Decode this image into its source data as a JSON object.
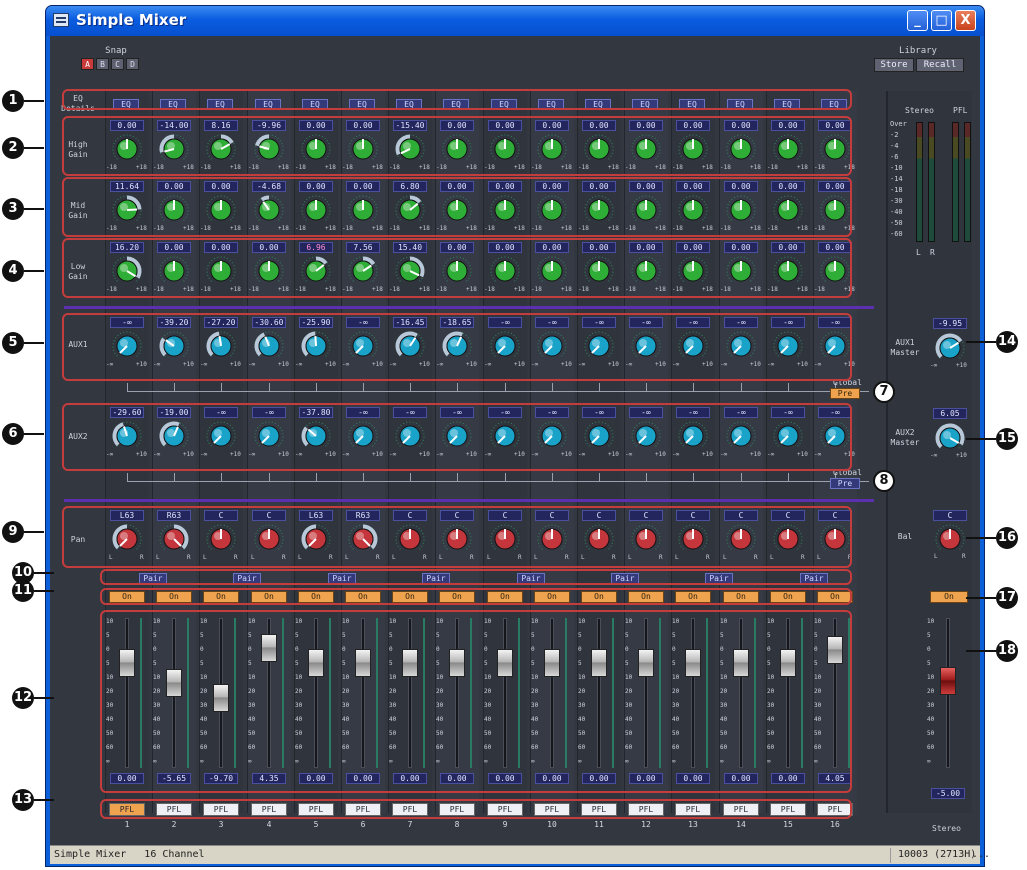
{
  "window": {
    "title": "Simple Mixer",
    "minimize": "_",
    "maximize": "□",
    "close": "X"
  },
  "snap": {
    "label": "Snap",
    "buttons": [
      "A",
      "B",
      "C",
      "D"
    ],
    "active": "A"
  },
  "library": {
    "label": "Library",
    "store": "Store",
    "recall": "Recall"
  },
  "rows": {
    "eq_details": "EQ\nDetails",
    "high_gain": "High\nGain",
    "mid_gain": "Mid\nGain",
    "low_gain": "Low\nGain",
    "aux1": "AUX1",
    "aux2": "AUX2",
    "pan": "Pan"
  },
  "eq_button": "EQ",
  "knob_range_eq": {
    "min": "-18",
    "max": "+18"
  },
  "knob_range_aux": {
    "min": "-∞",
    "max": "+10"
  },
  "knob_range_pan": {
    "min": "L",
    "max": "R"
  },
  "channels": [
    {
      "num": "1",
      "high": "0.00",
      "mid": "11.64",
      "low": "16.20",
      "aux1": "-∞",
      "aux2": "-29.60",
      "pan": "L63",
      "fader": "0.00",
      "fader_pos": 0.7,
      "pfl_on": true
    },
    {
      "num": "2",
      "high": "-14.00",
      "mid": "0.00",
      "low": "0.00",
      "aux1": "-39.20",
      "aux2": "-19.00",
      "pan": "R63",
      "fader": "-5.65",
      "fader_pos": 0.57,
      "pfl_on": false
    },
    {
      "num": "3",
      "high": "8.16",
      "mid": "0.00",
      "low": "0.00",
      "aux1": "-27.20",
      "aux2": "-∞",
      "pan": "C",
      "fader": "-9.70",
      "fader_pos": 0.47,
      "pfl_on": false
    },
    {
      "num": "4",
      "high": "-9.96",
      "mid": "-4.68",
      "low": "0.00",
      "aux1": "-30.60",
      "aux2": "-∞",
      "pan": "C",
      "fader": "4.35",
      "fader_pos": 0.8,
      "pfl_on": false
    },
    {
      "num": "5",
      "high": "0.00",
      "mid": "0.00",
      "low": "6.96",
      "aux1": "-25.90",
      "aux2": "-37.80",
      "pan": "L63",
      "fader": "0.00",
      "fader_pos": 0.7,
      "pfl_on": false
    },
    {
      "num": "6",
      "high": "0.00",
      "mid": "0.00",
      "low": "7.56",
      "aux1": "-∞",
      "aux2": "-∞",
      "pan": "R63",
      "fader": "0.00",
      "fader_pos": 0.7,
      "pfl_on": false
    },
    {
      "num": "7",
      "high": "-15.40",
      "mid": "6.80",
      "low": "15.40",
      "aux1": "-16.45",
      "aux2": "-∞",
      "pan": "C",
      "fader": "0.00",
      "fader_pos": 0.7,
      "pfl_on": false
    },
    {
      "num": "8",
      "high": "0.00",
      "mid": "0.00",
      "low": "0.00",
      "aux1": "-18.65",
      "aux2": "-∞",
      "pan": "C",
      "fader": "0.00",
      "fader_pos": 0.7,
      "pfl_on": false
    },
    {
      "num": "9",
      "high": "0.00",
      "mid": "0.00",
      "low": "0.00",
      "aux1": "-∞",
      "aux2": "-∞",
      "pan": "C",
      "fader": "0.00",
      "fader_pos": 0.7,
      "pfl_on": false
    },
    {
      "num": "10",
      "high": "0.00",
      "mid": "0.00",
      "low": "0.00",
      "aux1": "-∞",
      "aux2": "-∞",
      "pan": "C",
      "fader": "0.00",
      "fader_pos": 0.7,
      "pfl_on": false
    },
    {
      "num": "11",
      "high": "0.00",
      "mid": "0.00",
      "low": "0.00",
      "aux1": "-∞",
      "aux2": "-∞",
      "pan": "C",
      "fader": "0.00",
      "fader_pos": 0.7,
      "pfl_on": false
    },
    {
      "num": "12",
      "high": "0.00",
      "mid": "0.00",
      "low": "0.00",
      "aux1": "-∞",
      "aux2": "-∞",
      "pan": "C",
      "fader": "0.00",
      "fader_pos": 0.7,
      "pfl_on": false
    },
    {
      "num": "13",
      "high": "0.00",
      "mid": "0.00",
      "low": "0.00",
      "aux1": "-∞",
      "aux2": "-∞",
      "pan": "C",
      "fader": "0.00",
      "fader_pos": 0.7,
      "pfl_on": false
    },
    {
      "num": "14",
      "high": "0.00",
      "mid": "0.00",
      "low": "0.00",
      "aux1": "-∞",
      "aux2": "-∞",
      "pan": "C",
      "fader": "0.00",
      "fader_pos": 0.7,
      "pfl_on": false
    },
    {
      "num": "15",
      "high": "0.00",
      "mid": "0.00",
      "low": "0.00",
      "aux1": "-∞",
      "aux2": "-∞",
      "pan": "C",
      "fader": "0.00",
      "fader_pos": 0.7,
      "pfl_on": false
    },
    {
      "num": "16",
      "high": "0.00",
      "mid": "0.00",
      "low": "0.00",
      "aux1": "-∞",
      "aux2": "-∞",
      "pan": "C",
      "fader": "4.05",
      "fader_pos": 0.79,
      "pfl_on": false
    }
  ],
  "pair_label": "Pair",
  "on_label": "On",
  "pfl_label": "PFL",
  "global_label": "Global",
  "pre_label": "Pre",
  "aux1_pre_on": true,
  "aux2_pre_on": false,
  "fader_scale": [
    "10",
    "5",
    "0",
    "5",
    "10",
    "20",
    "30",
    "40",
    "50",
    "60",
    "∞"
  ],
  "meter": {
    "stereo_label": "Stereo",
    "pfl_label": "PFL",
    "scale": [
      "Over",
      "-2",
      "-4",
      "-6",
      "-10",
      "-14",
      "-18",
      "-30",
      "-40",
      "-50",
      "-60"
    ],
    "l": "L",
    "r": "R"
  },
  "master": {
    "aux1_label": "AUX1\nMaster",
    "aux1_value": "-9.95",
    "aux2_label": "AUX2\nMaster",
    "aux2_value": "6.05",
    "bal_label": "Bal",
    "bal_value": "C",
    "on": "On",
    "stereo_fader": "-5.00",
    "stereo_fader_pos": 0.58,
    "stereo_label": "Stereo"
  },
  "status": {
    "left": "Simple Mixer   16 Channel",
    "right": "10003 (2713H)",
    "end": "..."
  },
  "callouts": [
    "1",
    "2",
    "3",
    "4",
    "5",
    "6",
    "7",
    "8",
    "9",
    "10",
    "11",
    "12",
    "13",
    "14",
    "15",
    "16",
    "17",
    "18"
  ]
}
